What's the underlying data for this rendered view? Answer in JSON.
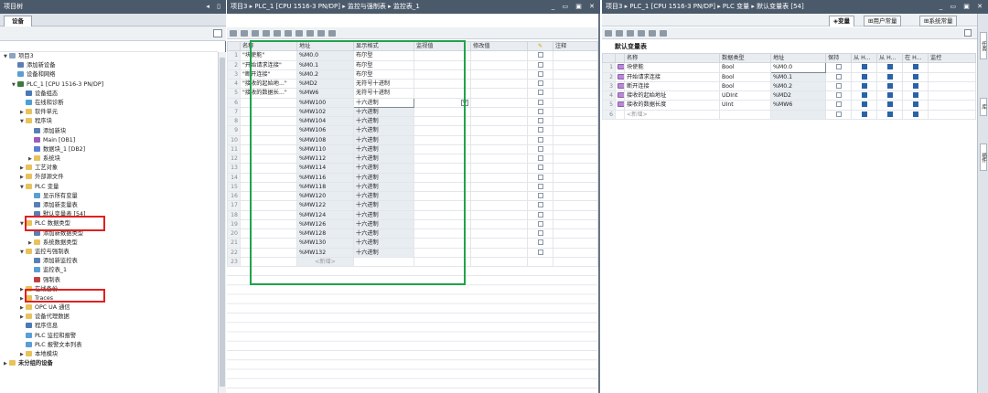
{
  "left_panel": {
    "title": "项目树",
    "header_buttons": "◂ ▯",
    "tab": "设备",
    "tree": [
      {
        "label": "项目3",
        "indent": 0,
        "arrow": "▼",
        "icon": "project",
        "color": "#8aa4c2"
      },
      {
        "label": "添加新设备",
        "indent": 1,
        "arrow": "",
        "icon": "add-device",
        "color": "#5a7fb5"
      },
      {
        "label": "设备和网络",
        "indent": 1,
        "arrow": "",
        "icon": "network",
        "color": "#5a9fd4"
      },
      {
        "label": "PLC_1 [CPU 1516-3 PN/DP]",
        "indent": 1,
        "arrow": "▼",
        "icon": "plc",
        "color": "#3d7a3d"
      },
      {
        "label": "设备组态",
        "indent": 2,
        "arrow": "",
        "icon": "config",
        "color": "#4a78b8"
      },
      {
        "label": "在线和诊断",
        "indent": 2,
        "arrow": "",
        "icon": "diagnostics",
        "color": "#4aa0d6"
      },
      {
        "label": "软件单元",
        "indent": 2,
        "arrow": "▶",
        "icon": "folder",
        "color": "#e8c25a"
      },
      {
        "label": "程序块",
        "indent": 2,
        "arrow": "▼",
        "icon": "folder",
        "color": "#e8c25a"
      },
      {
        "label": "添加新块",
        "indent": 3,
        "arrow": "",
        "icon": "add-block",
        "color": "#5a7fb5"
      },
      {
        "label": "Main [OB1]",
        "indent": 3,
        "arrow": "",
        "icon": "ob",
        "color": "#a05ab8"
      },
      {
        "label": "数据块_1 [DB2]",
        "indent": 3,
        "arrow": "",
        "icon": "db",
        "color": "#5a7fd4"
      },
      {
        "label": "系统块",
        "indent": 3,
        "arrow": "▶",
        "icon": "folder",
        "color": "#e8c25a"
      },
      {
        "label": "工艺对象",
        "indent": 2,
        "arrow": "▶",
        "icon": "folder",
        "color": "#e8c25a"
      },
      {
        "label": "外部源文件",
        "indent": 2,
        "arrow": "▶",
        "icon": "folder",
        "color": "#e8c25a"
      },
      {
        "label": "PLC 变量",
        "indent": 2,
        "arrow": "▼",
        "icon": "folder",
        "color": "#e8c25a"
      },
      {
        "label": "显示所有变量",
        "indent": 3,
        "arrow": "",
        "icon": "tags",
        "color": "#5a9fd4"
      },
      {
        "label": "添加新变量表",
        "indent": 3,
        "arrow": "",
        "icon": "add-table",
        "color": "#5a7fb5"
      },
      {
        "label": "默认变量表 [54]",
        "indent": 3,
        "arrow": "",
        "icon": "tag-table",
        "color": "#5a7fb5"
      },
      {
        "label": "PLC 数据类型",
        "indent": 2,
        "arrow": "▼",
        "icon": "folder",
        "color": "#e8c25a"
      },
      {
        "label": "添加新数据类型",
        "indent": 3,
        "arrow": "",
        "icon": "add-type",
        "color": "#5a7fb5"
      },
      {
        "label": "系统数据类型",
        "indent": 3,
        "arrow": "▶",
        "icon": "folder",
        "color": "#e8c25a"
      },
      {
        "label": "监控与强制表",
        "indent": 2,
        "arrow": "▼",
        "icon": "folder",
        "color": "#e8c25a"
      },
      {
        "label": "添加新监控表",
        "indent": 3,
        "arrow": "",
        "icon": "add-watch",
        "color": "#5a7fb5"
      },
      {
        "label": "监控表_1",
        "indent": 3,
        "arrow": "",
        "icon": "watch-table",
        "color": "#5a9fd4"
      },
      {
        "label": "强制表",
        "indent": 3,
        "arrow": "",
        "icon": "force-table",
        "color": "#c04040"
      },
      {
        "label": "在线备份",
        "indent": 2,
        "arrow": "▶",
        "icon": "folder",
        "color": "#e8c25a"
      },
      {
        "label": "Traces",
        "indent": 2,
        "arrow": "▶",
        "icon": "folder",
        "color": "#e8c25a"
      },
      {
        "label": "OPC UA 通信",
        "indent": 2,
        "arrow": "▶",
        "icon": "folder",
        "color": "#e8c25a"
      },
      {
        "label": "设备代理数据",
        "indent": 2,
        "arrow": "▶",
        "icon": "folder",
        "color": "#e8c25a"
      },
      {
        "label": "程序信息",
        "indent": 2,
        "arrow": "",
        "icon": "info",
        "color": "#4a78b8"
      },
      {
        "label": "PLC 监控和报警",
        "indent": 2,
        "arrow": "",
        "icon": "alarm",
        "color": "#5a9fd4"
      },
      {
        "label": "PLC 报警文本列表",
        "indent": 2,
        "arrow": "",
        "icon": "text-list",
        "color": "#5a9fd4"
      },
      {
        "label": "本地模块",
        "indent": 2,
        "arrow": "▶",
        "icon": "folder",
        "color": "#e8c25a"
      },
      {
        "label": "未分组的设备",
        "indent": 0,
        "arrow": "▶",
        "icon": "folder",
        "color": "#e8c25a",
        "bold": true
      }
    ]
  },
  "middle_panel": {
    "breadcrumb": "项目3 ▸ PLC_1 [CPU 1516-3 PN/DP] ▸ 监控与强制表 ▸ 监控表_1",
    "header_buttons": "_ ▭ ▣ ✕",
    "columns": [
      "i",
      "名称",
      "地址",
      "显示格式",
      "监视值",
      "修改值",
      "✎",
      "注释"
    ],
    "rows": [
      {
        "n": "1",
        "name": "\"块使能\"",
        "addr": "%M0.0",
        "fmt": "布尔型"
      },
      {
        "n": "2",
        "name": "\"开始请求连接\"",
        "addr": "%M0.1",
        "fmt": "布尔型"
      },
      {
        "n": "3",
        "name": "\"断开连接\"",
        "addr": "%M0.2",
        "fmt": "布尔型"
      },
      {
        "n": "4",
        "name": "\"接收的起始地...\"",
        "addr": "%MD2",
        "fmt": "无符号十进制"
      },
      {
        "n": "5",
        "name": "\"接收的数据长...\"",
        "addr": "%MW6",
        "fmt": "无符号十进制"
      },
      {
        "n": "6",
        "name": "",
        "addr": "%MW100",
        "fmt": "十六进制"
      },
      {
        "n": "7",
        "name": "",
        "addr": "%MW102",
        "fmt": "十六进制"
      },
      {
        "n": "8",
        "name": "",
        "addr": "%MW104",
        "fmt": "十六进制"
      },
      {
        "n": "9",
        "name": "",
        "addr": "%MW106",
        "fmt": "十六进制"
      },
      {
        "n": "10",
        "name": "",
        "addr": "%MW108",
        "fmt": "十六进制"
      },
      {
        "n": "11",
        "name": "",
        "addr": "%MW110",
        "fmt": "十六进制"
      },
      {
        "n": "12",
        "name": "",
        "addr": "%MW112",
        "fmt": "十六进制"
      },
      {
        "n": "13",
        "name": "",
        "addr": "%MW114",
        "fmt": "十六进制"
      },
      {
        "n": "14",
        "name": "",
        "addr": "%MW116",
        "fmt": "十六进制"
      },
      {
        "n": "15",
        "name": "",
        "addr": "%MW118",
        "fmt": "十六进制"
      },
      {
        "n": "16",
        "name": "",
        "addr": "%MW120",
        "fmt": "十六进制"
      },
      {
        "n": "17",
        "name": "",
        "addr": "%MW122",
        "fmt": "十六进制"
      },
      {
        "n": "18",
        "name": "",
        "addr": "%MW124",
        "fmt": "十六进制"
      },
      {
        "n": "19",
        "name": "",
        "addr": "%MW126",
        "fmt": "十六进制"
      },
      {
        "n": "20",
        "name": "",
        "addr": "%MW128",
        "fmt": "十六进制"
      },
      {
        "n": "21",
        "name": "",
        "addr": "%MW130",
        "fmt": "十六进制"
      },
      {
        "n": "22",
        "name": "",
        "addr": "%MW132",
        "fmt": "十六进制"
      },
      {
        "n": "23",
        "name": "",
        "addr": "<新增>",
        "fmt": ""
      }
    ]
  },
  "right_panel": {
    "breadcrumb": "项目3 ▸ PLC_1 [CPU 1516-3 PN/DP] ▸ PLC 变量 ▸ 默认变量表 [54]",
    "header_buttons": "_ ▭ ▣ ✕",
    "tabs": [
      "变量",
      "用户常量",
      "系统常量"
    ],
    "table_title": "默认变量表",
    "columns": [
      "名称",
      "数据类型",
      "地址",
      "保持",
      "从 H...",
      "从 H...",
      "在 H...",
      "监控"
    ],
    "rows": [
      {
        "n": "1",
        "name": "块使能",
        "type": "Bool",
        "addr": "%M0.0"
      },
      {
        "n": "2",
        "name": "开始请求连接",
        "type": "Bool",
        "addr": "%M0.1"
      },
      {
        "n": "3",
        "name": "断开连接",
        "type": "Bool",
        "addr": "%M0.2"
      },
      {
        "n": "4",
        "name": "接收的起始地址",
        "type": "UDInt",
        "addr": "%MD2"
      },
      {
        "n": "5",
        "name": "接收的数据长度",
        "type": "UInt",
        "addr": "%MW6"
      },
      {
        "n": "6",
        "name": "<新增>",
        "type": "",
        "addr": ""
      }
    ],
    "side_tabs": [
      "任务",
      "库",
      "插件"
    ]
  }
}
